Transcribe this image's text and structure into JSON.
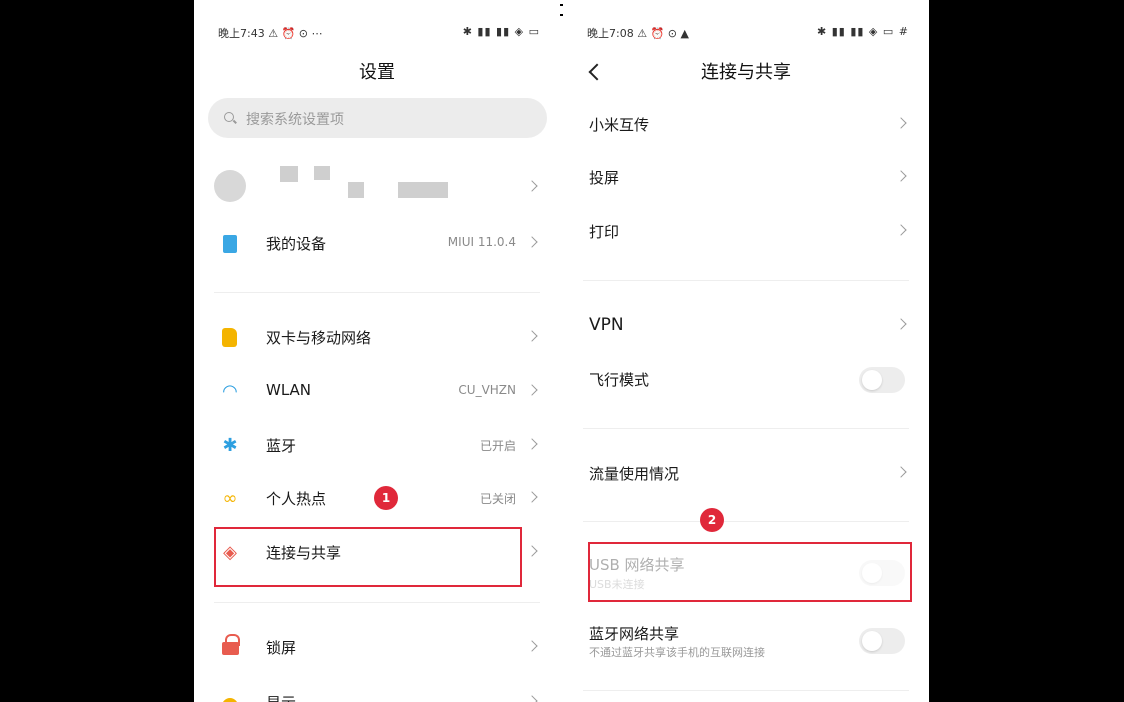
{
  "left": {
    "status_time": "晚上7:43 ⚠ ⏰ ⊙ ⋯",
    "status_icons": "✱ ▮▮ ▮▮ ◈ ▭",
    "title": "设置",
    "search_placeholder": "搜索系统设置项",
    "my_device": {
      "label": "我的设备",
      "value": "MIUI 11.0.4"
    },
    "items": [
      {
        "label": "双卡与移动网络",
        "value": ""
      },
      {
        "label": "WLAN",
        "value": "CU_VHZN"
      },
      {
        "label": "蓝牙",
        "value": "已开启"
      },
      {
        "label": "个人热点",
        "value": "已关闭"
      },
      {
        "label": "连接与共享",
        "value": ""
      },
      {
        "label": "锁屏",
        "value": ""
      },
      {
        "label": "显示",
        "value": ""
      }
    ],
    "step_badge": "1"
  },
  "right": {
    "status_time": "晚上7:08 ⚠ ⏰ ⊙ ▲",
    "status_icons": "✱ ▮▮ ▮▮ ◈ ▭ #",
    "title": "连接与共享",
    "items": {
      "mi_share": "小米互传",
      "cast": "投屏",
      "print": "打印",
      "vpn": "VPN",
      "airplane": "飞行模式",
      "data_usage": "流量使用情况",
      "usb_tether": {
        "label": "USB 网络共享",
        "sub": "USB未连接"
      },
      "bt_tether": {
        "label": "蓝牙网络共享",
        "sub": "不通过蓝牙共享该手机的互联网连接"
      }
    },
    "step_badge": "2"
  },
  "colors": {
    "highlight": "#e0283a",
    "wlan": "#2d9fe0",
    "bluetooth": "#2d9fe0",
    "hotspot": "#f4b400",
    "share": "#e85c4f"
  }
}
